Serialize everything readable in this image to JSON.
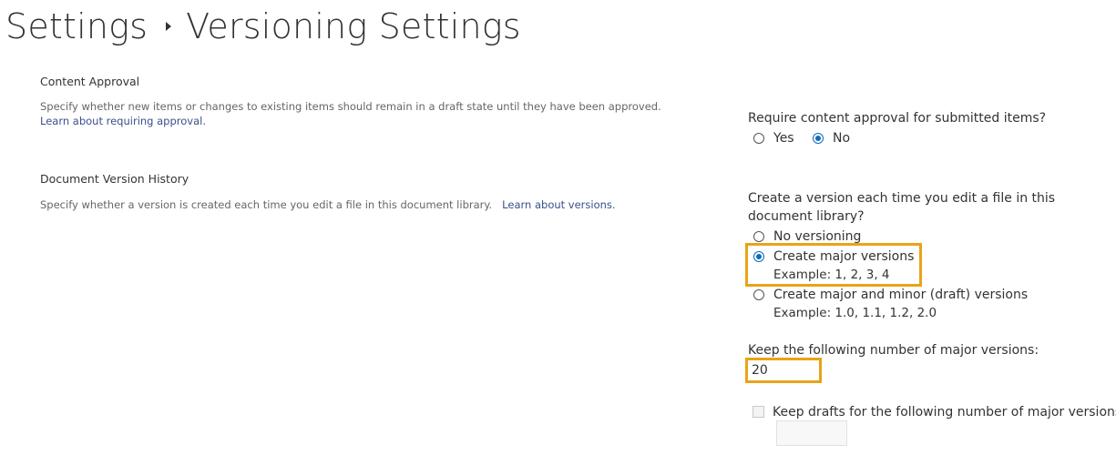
{
  "breadcrumb": {
    "parent": "Settings",
    "current": "Versioning Settings"
  },
  "content_approval": {
    "title": "Content Approval",
    "description": "Specify whether new items or changes to existing items should remain in a draft state until they have been approved.",
    "learn_more_link": "Learn about requiring approval.",
    "question": "Require content approval for submitted items?",
    "options": [
      "Yes",
      "No"
    ],
    "selected": "No"
  },
  "version_history": {
    "title": "Document Version History",
    "description": "Specify whether a version is created each time you edit a file in this document library.",
    "learn_more_link": "Learn about versions.",
    "question": "Create a version each time you edit a file in this document library?",
    "options": [
      {
        "label": "No versioning",
        "example": ""
      },
      {
        "label": "Create major versions",
        "example": "Example: 1, 2, 3, 4"
      },
      {
        "label": "Create major and minor (draft) versions",
        "example": "Example: 1.0, 1.1, 1.2, 2.0"
      }
    ],
    "selected": "Create major versions",
    "major_versions_label": "Keep the following number of major versions:",
    "major_versions_value": "20",
    "drafts_label": "Keep drafts for the following number of major versions:",
    "drafts_checked": false,
    "drafts_value": ""
  },
  "colors": {
    "highlight": "#e8a317",
    "radio_selected": "#0f6cbd",
    "link": "#3b4f8c"
  }
}
